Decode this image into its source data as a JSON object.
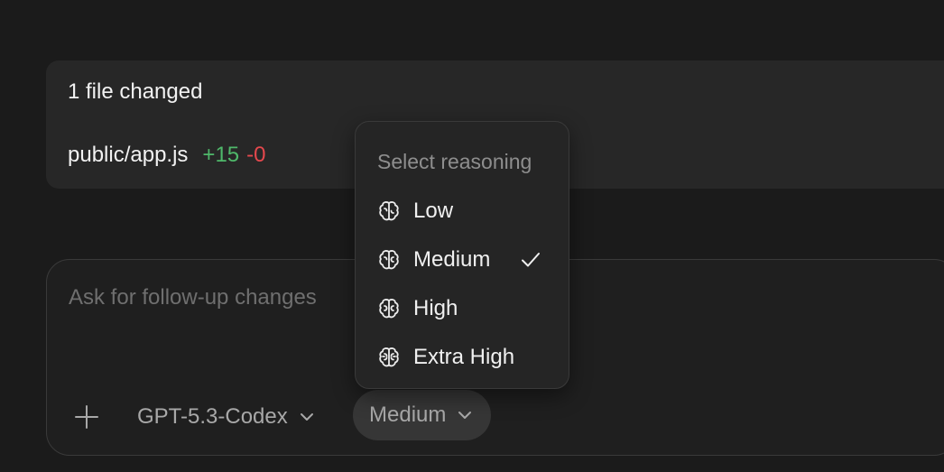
{
  "changes": {
    "title": "1 file changed",
    "files": [
      {
        "name": "public/app.js",
        "additions": "+15",
        "deletions": "-0"
      }
    ]
  },
  "composer": {
    "placeholder": "Ask for follow-up changes",
    "model_label": "GPT-5.3-Codex",
    "reasoning_label": "Medium",
    "add_icon": "plus-icon",
    "dropdown_icon": "chevron-down-icon"
  },
  "reasoning_menu": {
    "header": "Select reasoning",
    "items": [
      {
        "label": "Low",
        "icon": "brain-icon",
        "selected": false
      },
      {
        "label": "Medium",
        "icon": "brain-icon",
        "selected": true
      },
      {
        "label": "High",
        "icon": "brain-icon",
        "selected": false
      },
      {
        "label": "Extra High",
        "icon": "brain-icon",
        "selected": false
      }
    ],
    "selected_icon": "checkmark-icon"
  },
  "colors": {
    "background": "#1b1b1b",
    "card": "#272727",
    "additions": "#4fb86a",
    "deletions": "#e5484d",
    "muted_text": "#a8a8a8"
  }
}
